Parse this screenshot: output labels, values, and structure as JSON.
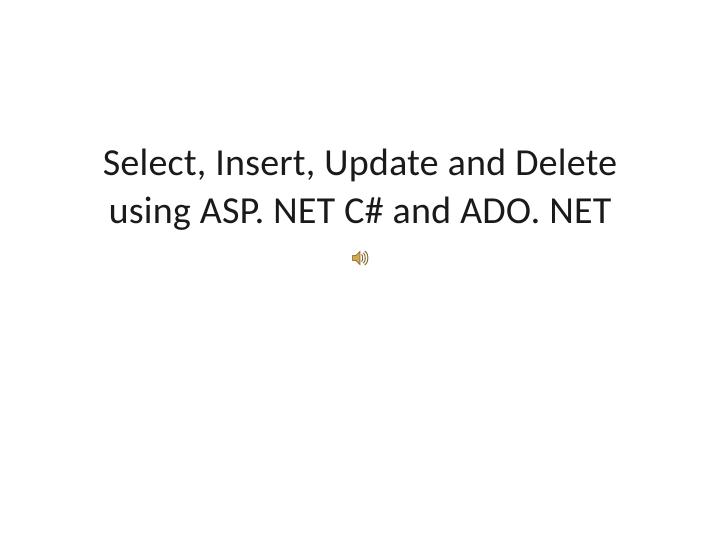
{
  "slide": {
    "title_line1": "Select, Insert, Update and Delete",
    "title_line2": "using ASP. NET C# and ADO. NET"
  },
  "icons": {
    "speaker": "speaker-icon"
  }
}
